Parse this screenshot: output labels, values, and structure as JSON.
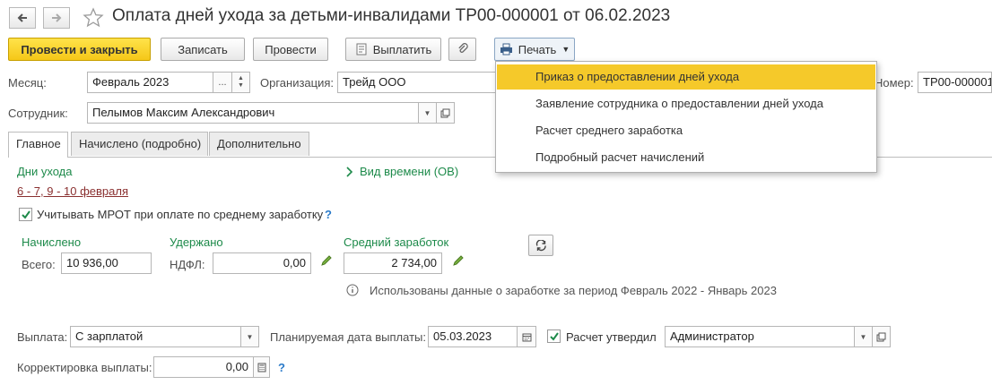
{
  "title": "Оплата дней ухода за детьми-инвалидами ТР00-000001 от 06.02.2023",
  "toolbar": {
    "post_close": "Провести и закрыть",
    "save": "Записать",
    "post": "Провести",
    "pay": "Выплатить",
    "print": "Печать"
  },
  "print_menu": [
    "Приказ о предоставлении дней ухода",
    "Заявление сотрудника о предоставлении дней ухода",
    "Расчет среднего заработка",
    "Подробный расчет начислений"
  ],
  "header": {
    "month_label": "Месяц:",
    "month_value": "Февраль 2023",
    "month_select": "...",
    "org_label": "Организация:",
    "org_value": "Трейд ООО",
    "number_label": "Номер:",
    "number_value": "ТР00-000001",
    "employee_label": "Сотрудник:",
    "employee_value": "Пелымов Максим Александрович"
  },
  "tabs": [
    "Главное",
    "Начислено (подробно)",
    "Дополнительно"
  ],
  "main": {
    "care_days_label": "Дни ухода",
    "care_days_value": "6 - 7, 9 - 10 февраля",
    "time_type": "Вид времени (ОВ)",
    "mrot_label": "Учитывать МРОТ при оплате по среднему заработку",
    "mrot_checked": true,
    "help": "?",
    "accrued_label": "Начислено",
    "total_label": "Всего:",
    "total_value": "10 936,00",
    "withheld_label": "Удержано",
    "ndfl_label": "НДФЛ:",
    "ndfl_value": "0,00",
    "avg_label": "Средний заработок",
    "avg_value": "2 734,00",
    "info_text": "Использованы данные о заработке за период Февраль 2022 - Январь 2023"
  },
  "footer": {
    "payment_label": "Выплата:",
    "payment_value": "С зарплатой",
    "planned_date_label": "Планируемая дата выплаты:",
    "planned_date_value": "05.03.2023",
    "approved_label": "Расчет утвердил",
    "approved_checked": true,
    "approved_value": "Администратор",
    "correction_label": "Корректировка выплаты:",
    "correction_value": "0,00"
  },
  "colors": {
    "primary_button": "#f5c718",
    "menu_highlight": "#f5c92a",
    "section_green": "#1d8a4a",
    "link_red": "#8a3030",
    "help_blue": "#2a7ac9"
  }
}
